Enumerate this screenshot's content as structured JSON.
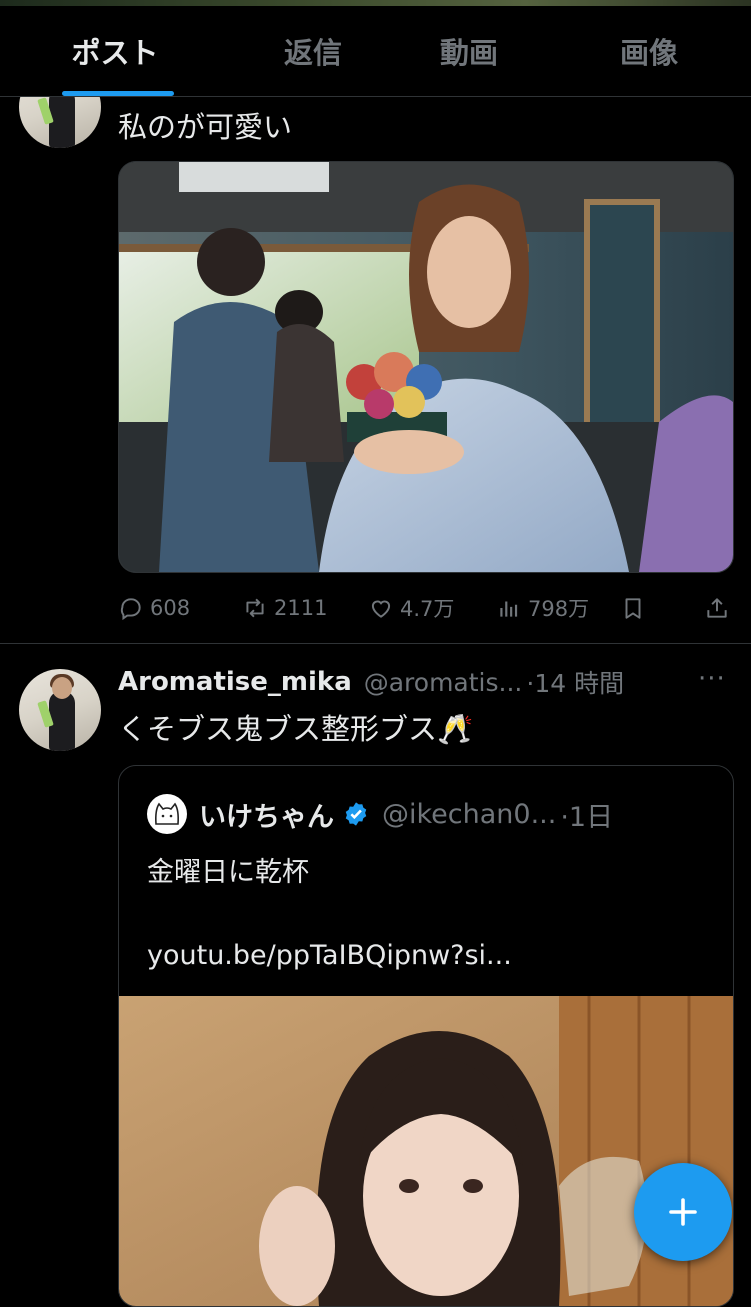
{
  "tabs": [
    {
      "label": "ポスト",
      "active": true
    },
    {
      "label": "返信",
      "active": false
    },
    {
      "label": "動画",
      "active": false
    },
    {
      "label": "画像",
      "active": false
    }
  ],
  "post1": {
    "text": "私のが可愛い",
    "media_icon": "photo",
    "stats": {
      "replies": "608",
      "reposts": "2111",
      "likes": "4.7万",
      "views": "798万"
    }
  },
  "post2": {
    "display_name": "Aromatise_mika",
    "handle": "@aromatis...",
    "time": "·14 時間",
    "more": "···",
    "text": "くそブス鬼ブス整形ブス🥂",
    "quote": {
      "display_name": "いけちゃん",
      "verified": true,
      "handle": "@ikechan0...",
      "time": "·1日",
      "line1": "金曜日に乾杯",
      "link": "youtu.be/ppTaIBQipnw?si..."
    }
  },
  "colors": {
    "accent": "#1d9bf0",
    "background": "#000000",
    "text_primary": "#e7e9ea",
    "text_secondary": "#71767b"
  },
  "fab": {
    "icon": "plus-icon"
  }
}
